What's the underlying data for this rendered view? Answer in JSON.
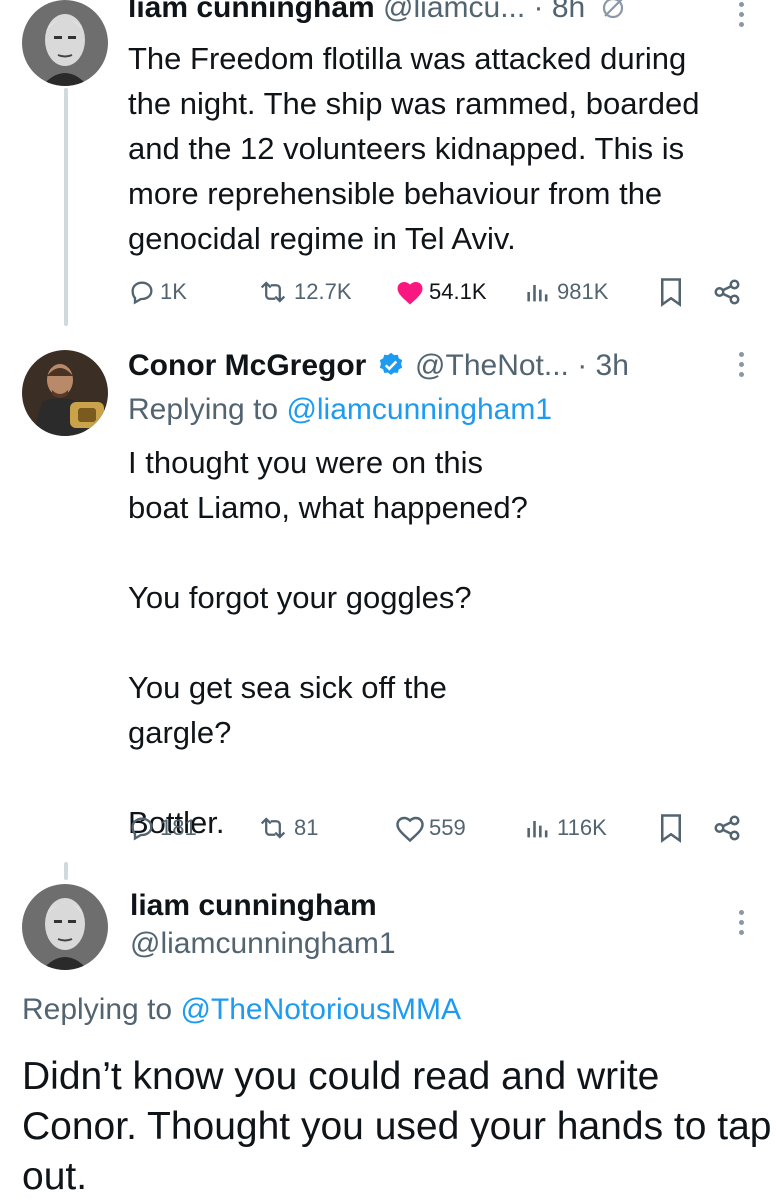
{
  "tweets": [
    {
      "author_name": "liam cunningham",
      "handle": "@liamcu...",
      "time": "· 8h",
      "text_lines": [
        "The Freedom flotilla was attacked during",
        "the night. The ship was rammed, boarded",
        "and the 12 volunteers kidnapped. This is",
        "more reprehensible behaviour from the",
        "genocidal regime in Tel Aviv."
      ],
      "stats": {
        "replies": "1K",
        "reposts": "12.7K",
        "likes": "54.1K",
        "views": "981K"
      },
      "liked": true
    },
    {
      "author_name": "Conor McGregor",
      "verified": true,
      "handle": "@TheNot...",
      "time": "· 3h",
      "replying_label": "Replying to",
      "replying_handle": "@liamcunningham1",
      "paragraphs": [
        "I thought you were on this boat Liamo, what happened?",
        "You forgot your goggles?",
        "You get sea sick off the gargle?",
        "Bottler."
      ],
      "stats": {
        "replies": "181",
        "reposts": "81",
        "likes": "559",
        "views": "116K"
      },
      "liked": false
    },
    {
      "author_name": "liam cunningham",
      "handle": "@liamcunningham1",
      "replying_label": "Replying to",
      "replying_handle": "@TheNotoriousMMA",
      "text": "Didn’t know you could read and write Conor. Thought you used your hands to tap out."
    }
  ],
  "colors": {
    "accent_blue": "#1d9bf0",
    "like_red": "#f91880",
    "muted_gray": "#536471",
    "text": "#0f1419"
  },
  "icons": {
    "reply": "reply-icon",
    "repost": "repost-icon",
    "like": "heart-icon",
    "views": "views-icon",
    "bookmark": "bookmark-icon",
    "share": "share-icon",
    "more": "more-icon",
    "verified": "verified-badge-icon",
    "paper_plane": "edited-icon"
  }
}
